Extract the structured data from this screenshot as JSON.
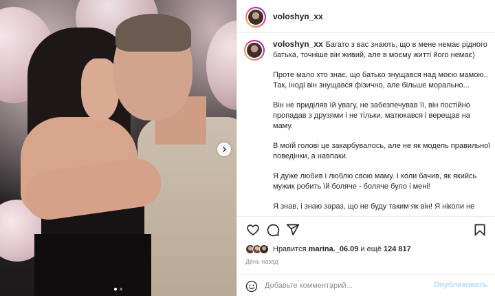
{
  "post": {
    "username": "voloshyn_xx",
    "caption_paragraphs": [
      "Багато з вас знають, що в мене немає рідного батька, точніше він живий, але в моєму житті його немає)",
      "Проте мало хто знає, що батько знущався над моєю мамою.. Так, іноді він знущався фізично, але більше морально...",
      "Він не приділяв їй увагу, не забезпечував її, він постійно пропадав з друзями і не тільки, матюкався і верещав на маму.",
      "В моїй голові це закарбувалось, але не як модель правильної поведінки, а навпаки.",
      "Я дуже любив і люблю свою маму. І коли бачив, як якийсь мужик робить їй боляче - боляче було і мені!",
      "Я знав, і знаю зараз, що не буду таким як він! Я ніколи не буду себе поводити з жінками так, як поводить себе він."
    ],
    "carousel": {
      "total": 2,
      "active": 1
    }
  },
  "icons": [
    "heart-icon",
    "comment-icon",
    "share-icon",
    "bookmark-icon",
    "emoji-icon",
    "chevron-right-icon"
  ],
  "likes": {
    "prefix": "Нравится ",
    "user": "marina._06.09",
    "middle": " и ещё ",
    "count": "124 817"
  },
  "time_ago": "День назад",
  "comment_box": {
    "placeholder": "Добавьте комментарий...",
    "publish_label": "Опубликовать"
  },
  "colors": {
    "publish_disabled": "#b3dbff",
    "muted_text": "#8e8e8e",
    "text": "#262626"
  }
}
